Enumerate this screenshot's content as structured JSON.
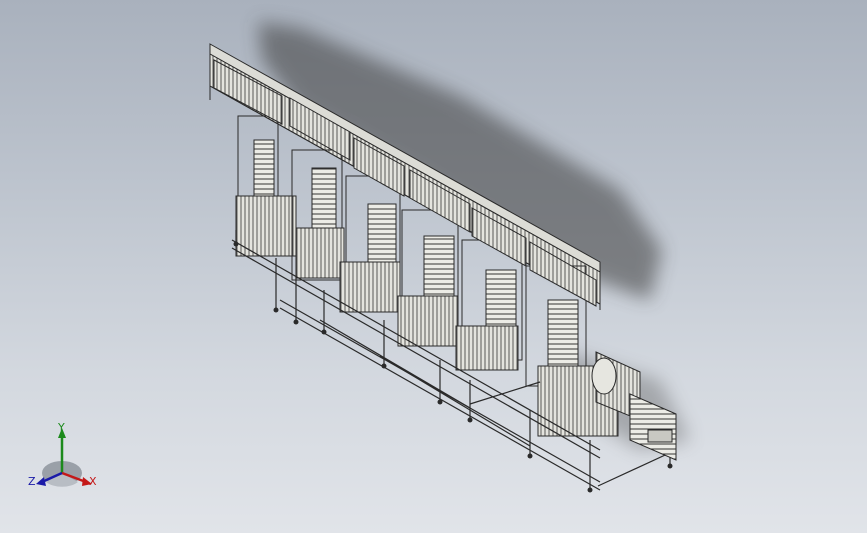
{
  "viewport": {
    "background_top": "#a9b1bd",
    "background_bottom": "#e1e4e9"
  },
  "model": {
    "line_color": "#2a2a2a",
    "frame_color": "#dcdcd6",
    "shadow_color": "#3e3e3e"
  },
  "triad": {
    "x_label": "X",
    "y_label": "Y",
    "z_label": "Z",
    "x_color": "#c41818",
    "y_color": "#1c8a1c",
    "z_color": "#1a1aa8",
    "icon": "coordinate-triad-icon"
  }
}
